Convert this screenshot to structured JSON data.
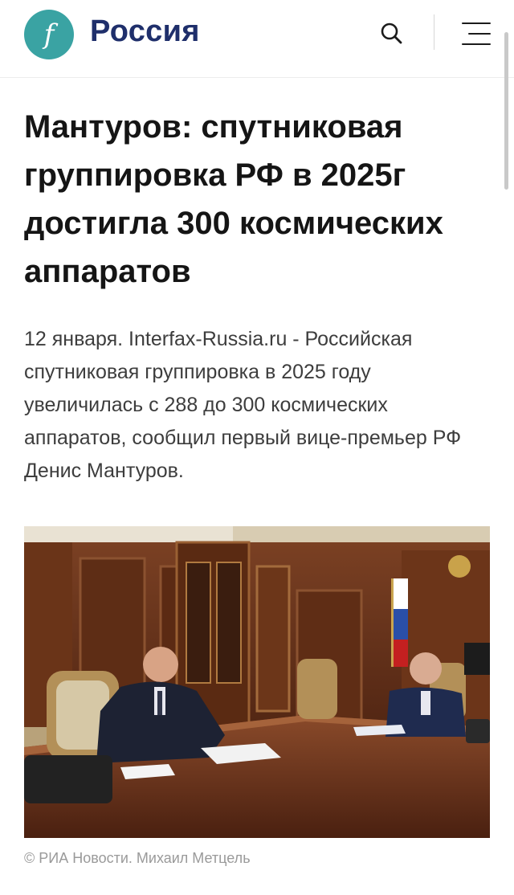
{
  "header": {
    "logo_letter": "f",
    "brand_name": "Россия",
    "search_icon": "search-icon",
    "menu_icon": "hamburger-menu-icon"
  },
  "article": {
    "title": "Мантуров: спутниковая группировка РФ в 2025г достигла 300 космических аппаратов",
    "lead": "12 января. Interfax-Russia.ru - Российская спутниковая группировка в 2025 году увеличилась с 288 до 300 космических аппаратов, сообщил первый вице-премьер РФ Денис Мантуров.",
    "photo_caption": "© РИА Новости. Михаил Метцель"
  },
  "colors": {
    "logo_bg": "#3aa3a3",
    "brand": "#1f2f6b",
    "caption": "#9a9a9a"
  }
}
